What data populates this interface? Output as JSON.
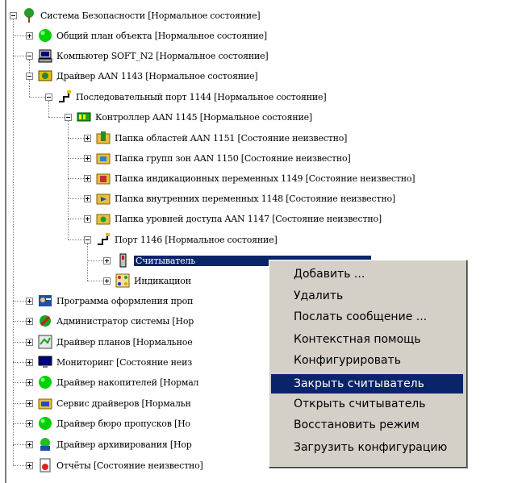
{
  "tree": {
    "nodes": [
      {
        "label": "Система Безопасности [Нормальное состояние]",
        "icon": "tree-icon",
        "toggle": "minus"
      },
      {
        "label": "Общий план объекта [Нормальное состояние]",
        "icon": "green-circle-icon",
        "toggle": "plus"
      },
      {
        "label": "Компьютер SOFT_N2 [Нормальное состояние]",
        "icon": "computer-icon",
        "toggle": "minus"
      },
      {
        "label": "Драйвер AAN 1143 [Нормальное состояние]",
        "icon": "driver-icon",
        "toggle": "minus"
      },
      {
        "label": "Последовательный порт 1144 [Нормальное состояние]",
        "icon": "serial-port-icon",
        "toggle": "minus"
      },
      {
        "label": "Контроллер AAN 1145 [Нормальное состояние]",
        "icon": "controller-icon",
        "toggle": "minus"
      },
      {
        "label": "Папка областей AAN 1151 [Состояние неизвестно]",
        "icon": "folder-areas-icon",
        "toggle": "plus"
      },
      {
        "label": "Папка групп зон AAN 1150 [Состояние неизвестно]",
        "icon": "folder-zone-groups-icon",
        "toggle": "plus"
      },
      {
        "label": "Папка индикационных переменных 1149 [Состояние неизвестно]",
        "icon": "folder-indication-icon",
        "toggle": "plus"
      },
      {
        "label": "Папка внутренних переменных 1148 [Состояние неизвестно]",
        "icon": "folder-internal-icon",
        "toggle": "plus"
      },
      {
        "label": "Папка уровней доступа AAN 1147 [Состояние неизвестно]",
        "icon": "folder-access-icon",
        "toggle": "plus"
      },
      {
        "label": "Порт 1146 [Нормальное состояние]",
        "icon": "port-icon",
        "toggle": "minus"
      },
      {
        "label": "Считыватель",
        "icon": "reader-icon",
        "toggle": "plus",
        "selected": true
      },
      {
        "label": "Индикацион",
        "icon": "indicator-icon",
        "toggle": "plus"
      },
      {
        "label": "Программа оформления проп",
        "icon": "badge-program-icon",
        "toggle": "plus"
      },
      {
        "label": "Администратор системы [Нор",
        "icon": "admin-icon",
        "toggle": "plus"
      },
      {
        "label": "Драйвер планов [Нормальное",
        "icon": "plans-driver-icon",
        "toggle": "plus"
      },
      {
        "label": "Мониторинг [Состояние неиз",
        "icon": "monitor-icon",
        "toggle": "plus"
      },
      {
        "label": "Драйвер накопителей [Нормал",
        "icon": "green-circle-icon",
        "toggle": "plus"
      },
      {
        "label": "Сервис драйверов [Нормальн",
        "icon": "service-icon",
        "toggle": "plus"
      },
      {
        "label": "Драйвер бюро пропусков [Но",
        "icon": "green-circle-icon",
        "toggle": "plus"
      },
      {
        "label": "Драйвер архивирования [Нор",
        "icon": "archive-icon",
        "toggle": "plus"
      },
      {
        "label": "Отчёты [Состояние неизвестно]",
        "icon": "reports-icon",
        "toggle": "plus"
      }
    ]
  },
  "context_menu": {
    "items": [
      {
        "label": "Добавить ..."
      },
      {
        "label": "Удалить"
      },
      {
        "label": "Послать сообщение ..."
      },
      {
        "label": "Контекстная помощь"
      },
      {
        "label": "Конфигурировать"
      },
      {
        "label": "Закрыть считыватель",
        "highlighted": true
      },
      {
        "label": "Открыть считыватель"
      },
      {
        "label": "Восстановить режим"
      },
      {
        "label": "Загрузить конфигурацию"
      }
    ]
  }
}
